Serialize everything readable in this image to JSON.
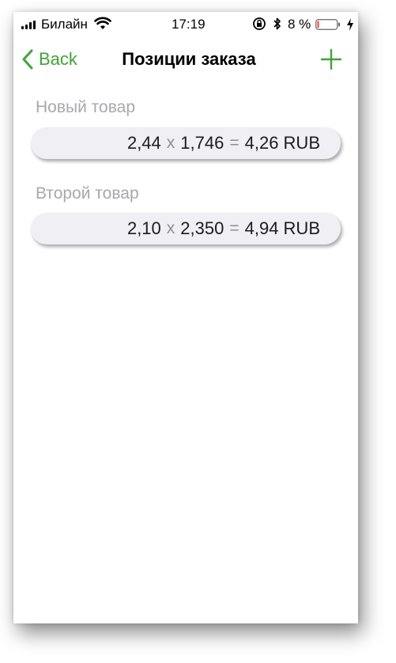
{
  "status_bar": {
    "carrier": "Билайн",
    "time": "17:19",
    "battery_percent": "8 %",
    "battery_level": 0.08
  },
  "nav": {
    "back_label": "Back",
    "title": "Позиции заказа"
  },
  "items": [
    {
      "name": "Новый товар",
      "price": "2,44",
      "quantity": "1,746",
      "total": "4,26 RUB"
    },
    {
      "name": "Второй товар",
      "price": "2,10",
      "quantity": "2,350",
      "total": "4,94 RUB"
    }
  ],
  "operators": {
    "multiply": "x",
    "equals": "="
  },
  "colors": {
    "accent": "#3fa535",
    "label": "#a8a8ad",
    "pill": "#efeff4",
    "battery_low": "#ff3b30"
  }
}
